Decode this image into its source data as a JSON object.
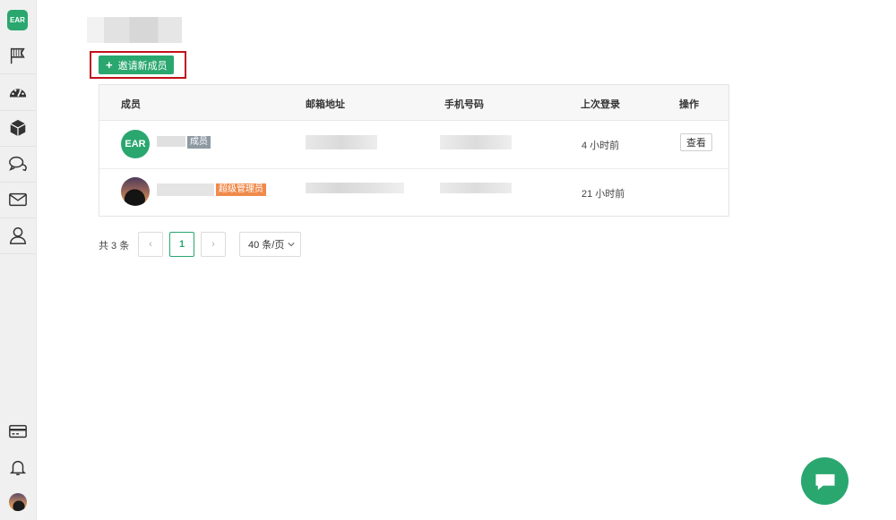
{
  "sidebar": {
    "logo": "EAR",
    "icons": [
      "flag-icon",
      "dashboard-icon",
      "cube-icon",
      "chat-bubbles-icon",
      "mail-icon",
      "user-icon"
    ],
    "bottom_icons": [
      "credit-card-icon",
      "bell-icon",
      "avatar"
    ]
  },
  "toolbar": {
    "invite_label": "邀请新成员",
    "invite_icon": "plus-icon"
  },
  "table": {
    "headers": [
      "成员",
      "邮箱地址",
      "手机号码",
      "上次登录",
      "操作"
    ],
    "rows": [
      {
        "avatar_text": "EAR",
        "role": "成员",
        "last_login": "4 小时前",
        "action": "查看"
      },
      {
        "role": "超级管理员",
        "last_login": "21 小时前"
      }
    ]
  },
  "pagination": {
    "total": "共 3 条",
    "prev": "‹",
    "current": "1",
    "next": "›",
    "page_size": "40 条/页"
  },
  "colors": {
    "accent": "#2aa76f",
    "admin_tag": "#f08a4b",
    "member_tag": "#8e9aa2",
    "highlight": "#c0111a"
  }
}
